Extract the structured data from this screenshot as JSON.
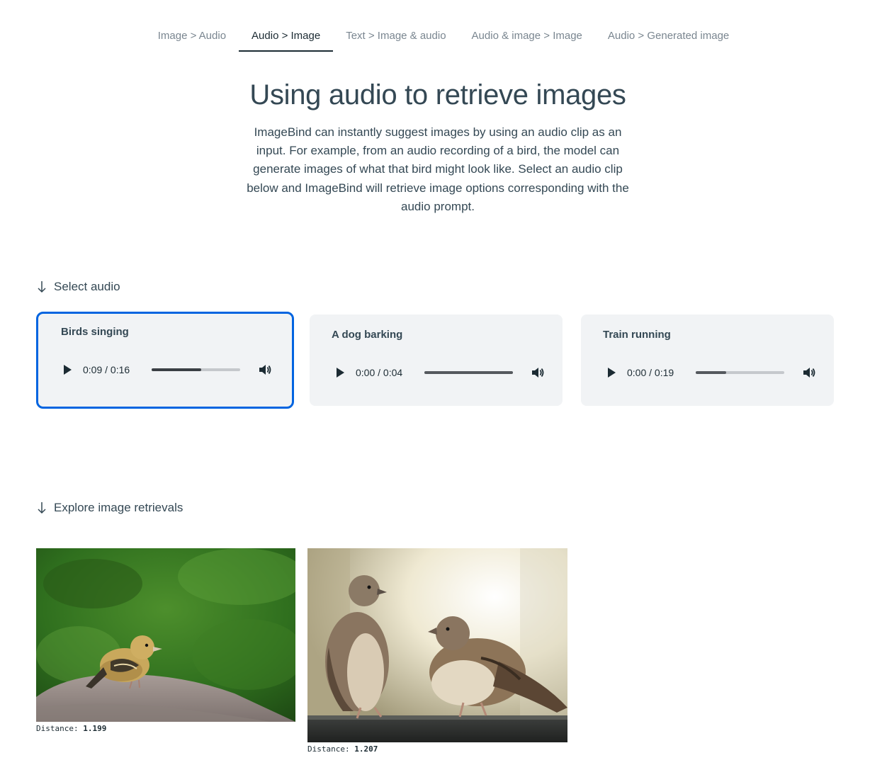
{
  "tabs": [
    {
      "label": "Image > Audio",
      "active": false
    },
    {
      "label": "Audio > Image",
      "active": true
    },
    {
      "label": "Text > Image & audio",
      "active": false
    },
    {
      "label": "Audio & image > Image",
      "active": false
    },
    {
      "label": "Audio > Generated image",
      "active": false
    }
  ],
  "hero": {
    "title": "Using audio to retrieve images",
    "description": "ImageBind can instantly suggest images by using an audio clip as an input. For example, from an audio recording of a bird, the model can generate images of what that bird might look like. Select an audio clip below and ImageBind will retrieve image options corresponding with the audio prompt."
  },
  "select_section": {
    "heading": "Select audio",
    "icon": "arrow-down-icon"
  },
  "audio_clips": [
    {
      "title": "Birds singing",
      "time": "0:09 / 0:16",
      "progress": 0.56,
      "selected": true
    },
    {
      "title": "A dog barking",
      "time": "0:00 / 0:04",
      "progress": 1.0,
      "selected": false
    },
    {
      "title": "Train running",
      "time": "0:00 / 0:19",
      "progress": 0.34,
      "selected": false
    }
  ],
  "player_icons": {
    "play": "play-icon",
    "volume": "volume-icon"
  },
  "explore_section": {
    "heading": "Explore image retrievals",
    "icon": "arrow-down-icon"
  },
  "results": [
    {
      "label": "Distance:",
      "value": "1.199",
      "subject": "small finch on a rock with green grass background"
    },
    {
      "label": "Distance:",
      "value": "1.207",
      "subject": "two sparrows facing each other on a ledge"
    }
  ],
  "colors": {
    "accent": "#0064e0",
    "text": "#344854",
    "card_bg": "#f1f3f5"
  }
}
